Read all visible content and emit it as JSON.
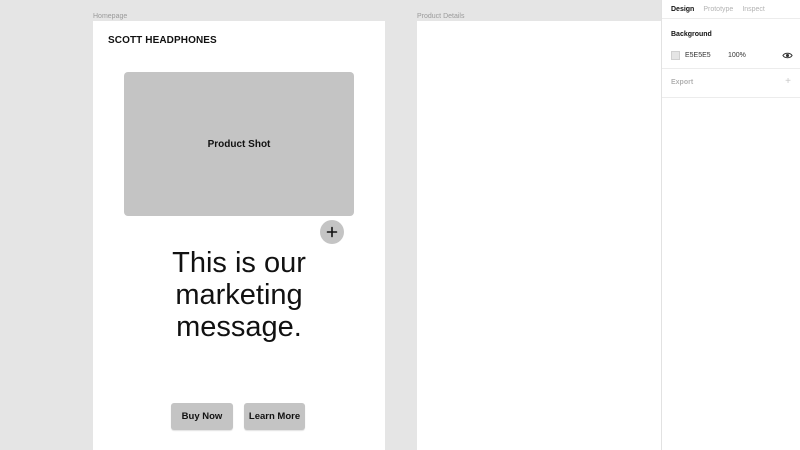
{
  "canvas": {
    "background_color": "#E5E5E5",
    "frames": [
      {
        "label": "Homepage"
      },
      {
        "label": "Product Details"
      }
    ]
  },
  "homepage": {
    "brand": "SCOTT HEADPHONES",
    "product_shot_label": "Product Shot",
    "add_icon": "plus-icon",
    "marketing_lines": [
      "This is our",
      "marketing",
      "message."
    ],
    "buttons": {
      "buy_now": "Buy Now",
      "learn_more": "Learn More"
    },
    "placeholder_color": "#C4C4C4"
  },
  "panel": {
    "tabs": [
      {
        "label": "Design",
        "active": true
      },
      {
        "label": "Prototype",
        "active": false
      },
      {
        "label": "Inspect",
        "active": false
      }
    ],
    "background": {
      "title": "Background",
      "hex": "E5E5E5",
      "opacity": "100%",
      "visibility_icon": "eye-icon"
    },
    "export": {
      "title": "Export",
      "add_icon": "plus-icon"
    }
  }
}
